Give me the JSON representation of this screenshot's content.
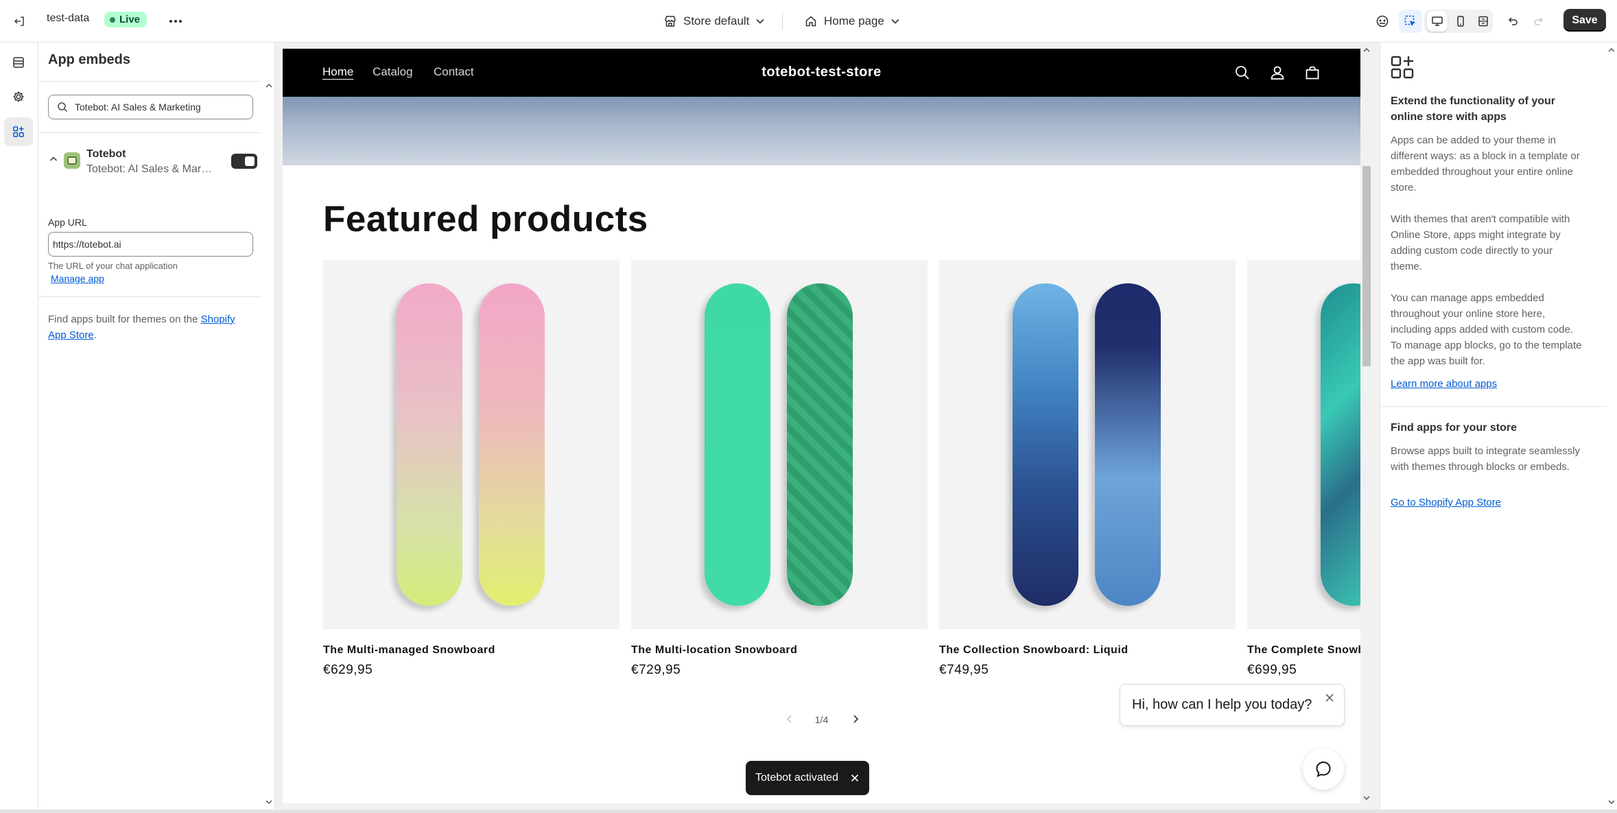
{
  "topbar": {
    "theme_name": "test-data",
    "live_badge": "Live",
    "store_selector": "Store default",
    "page_selector": "Home page",
    "save_label": "Save"
  },
  "sidebar": {
    "title": "App embeds",
    "search_value": "Totebot: AI Sales & Marketing",
    "app": {
      "name": "Totebot",
      "subtitle": "Totebot: AI Sales & Marketing",
      "enabled": true
    },
    "app_url_label": "App URL",
    "app_url_value": "https://totebot.ai",
    "app_url_help": "The URL of your chat application",
    "manage_app": "Manage app",
    "find_apps_prefix": "Find apps built for themes on the ",
    "find_apps_link": "Shopify App Store",
    "find_apps_suffix": "."
  },
  "store": {
    "nav": [
      "Home",
      "Catalog",
      "Contact"
    ],
    "store_name": "totebot-test-store",
    "section_title": "Featured products",
    "products": [
      {
        "title": "The Multi-managed Snowboard",
        "price": "€629,95"
      },
      {
        "title": "The Multi-location Snowboard",
        "price": "€729,95"
      },
      {
        "title": "The Collection Snowboard: Liquid",
        "price": "€749,95"
      },
      {
        "title": "The Complete Snowboard",
        "price": "€699,95"
      }
    ],
    "pager": "1/4",
    "chat_greeting": "Hi, how can I help you today?",
    "toast": "Totebot activated"
  },
  "right_panel": {
    "heading1": "Extend the functionality of your online store with apps",
    "para1": "Apps can be added to your theme in different ways: as a block in a template or embedded throughout your entire online store.",
    "para2": "With themes that aren't compatible with Online Store, apps might integrate by adding custom code directly to your theme.",
    "para3": "You can manage apps embedded throughout your online store here, including apps added with custom code. To manage app blocks, go to the template the app was built for.",
    "link1": "Learn more about apps",
    "heading2": "Find apps for your store",
    "para4": "Browse apps built to integrate seamlessly with themes through blocks or embeds.",
    "link2": "Go to Shopify App Store"
  },
  "colors": {
    "accent": "#005bd3",
    "live_badge_bg": "#b4fed2",
    "save_bg": "#303030",
    "store_nav_bg": "#000000"
  }
}
